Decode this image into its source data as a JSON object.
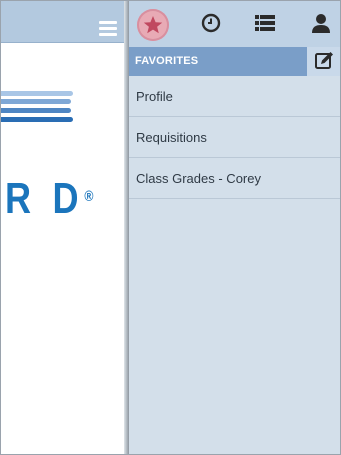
{
  "left_page": {
    "menu_icon": "hamburger-menu-icon",
    "logo": {
      "text": "R D",
      "registered_mark": "®",
      "color": "#1b75bc",
      "stripe_colors": [
        "#a9c6e6",
        "#7fa8d6",
        "#4f86c3",
        "#2a6db4"
      ]
    }
  },
  "panel": {
    "header_icons": [
      "star-icon",
      "clock-icon",
      "list-icon",
      "user-icon"
    ],
    "favorites": {
      "title": "FAVORITES",
      "edit_icon": "edit-icon",
      "items": [
        {
          "label": "Profile"
        },
        {
          "label": "Requisitions"
        },
        {
          "label": "Class Grades - Corey"
        }
      ]
    }
  },
  "colors": {
    "header_blue": "#b3c9df",
    "panel_bg": "#d3dfea",
    "favorites_bar": "#7a9ec8",
    "active_star_bg": "#e8aab5",
    "star_color": "#c0485f"
  }
}
